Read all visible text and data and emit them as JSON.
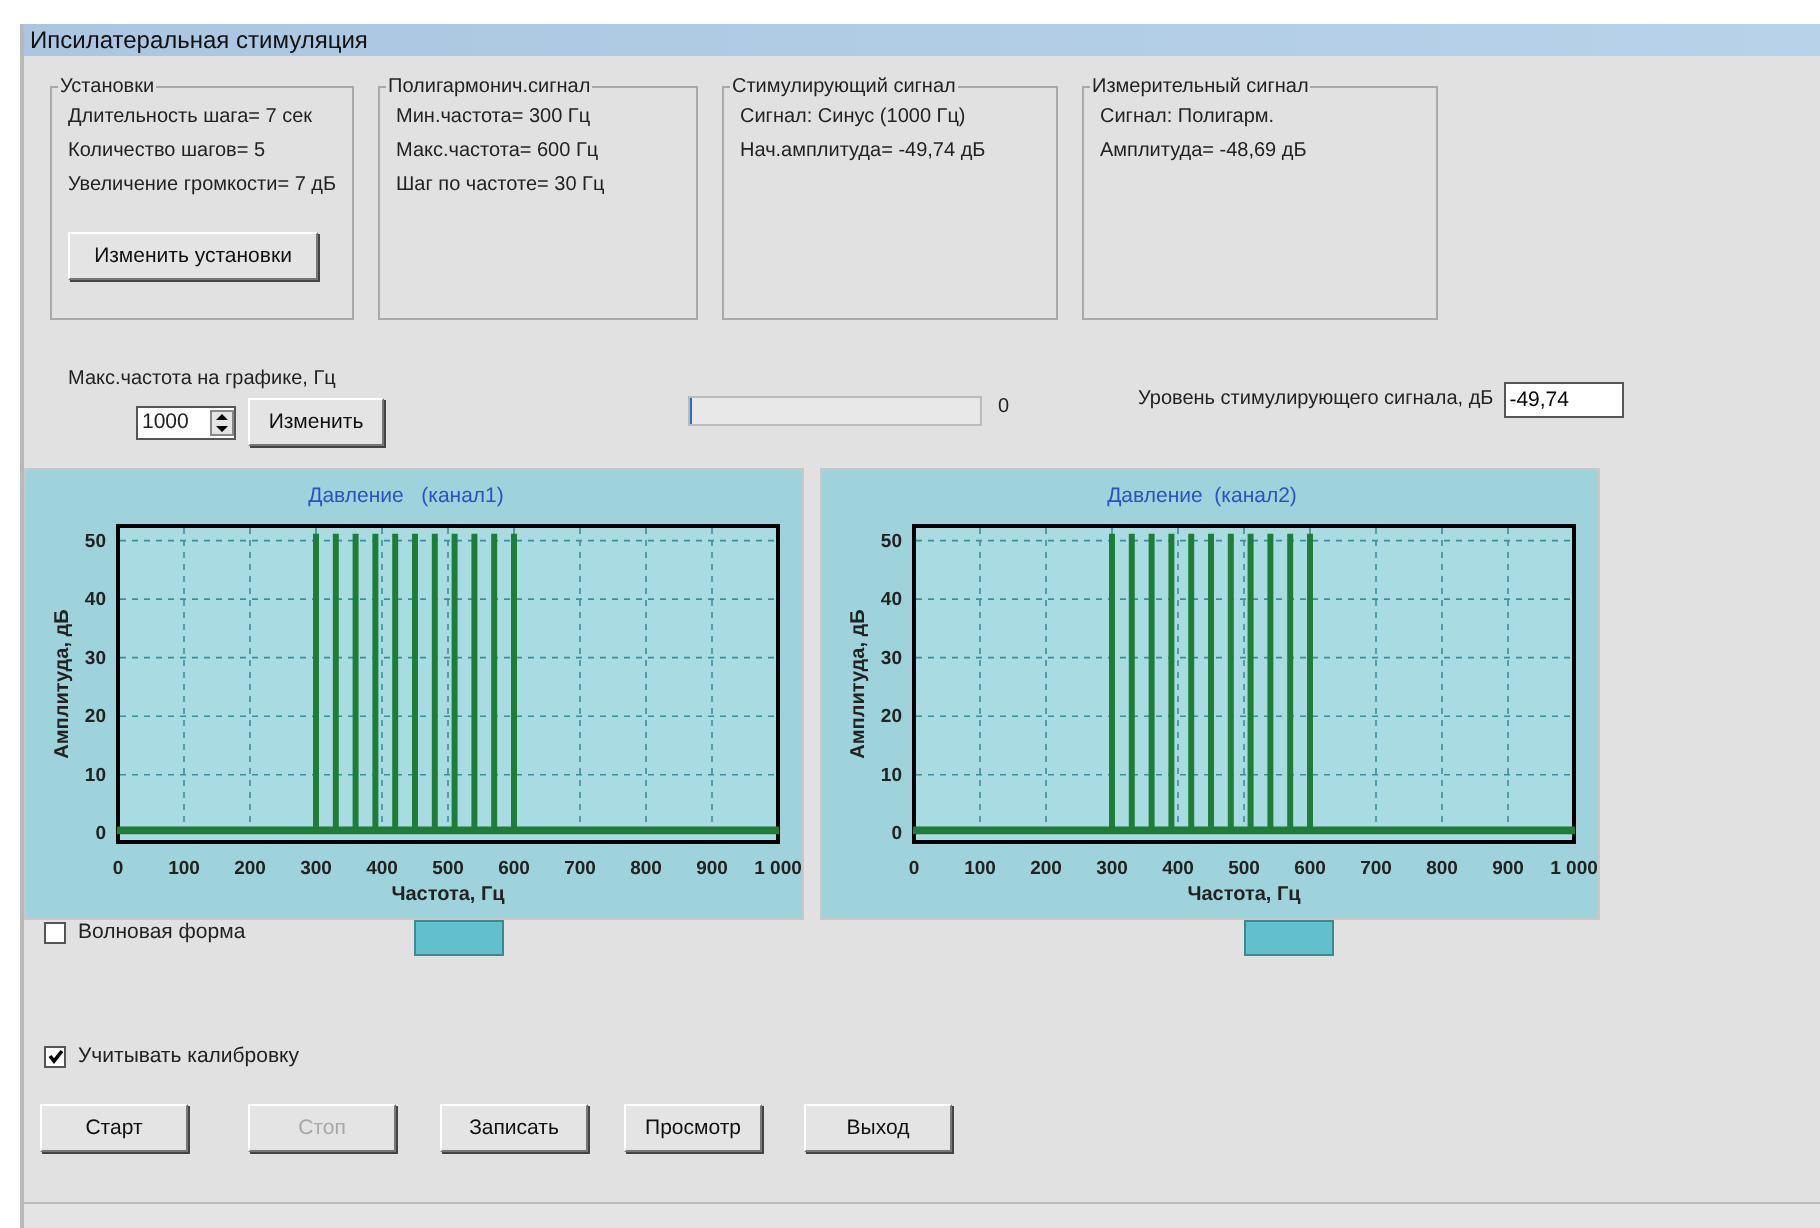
{
  "window": {
    "title": "Ипсилатеральная стимуляция"
  },
  "groups": [
    {
      "title": "Установки",
      "lines": [
        "Длительность шага= 7 сек",
        "Количество шагов= 5",
        "Увеличение громкости= 7 дБ"
      ],
      "button": "Изменить установки"
    },
    {
      "title": "Полигармонич.сигнал",
      "lines": [
        "Мин.частота= 300 Гц",
        "Макс.частота= 600 Гц",
        "Шаг по частоте= 30 Гц"
      ]
    },
    {
      "title": "Стимулирующий сигнал",
      "lines": [
        "Сигнал: Синус (1000 Гц)",
        "Нач.амплитуда= -49,74 дБ"
      ]
    },
    {
      "title": "Измерительный сигнал",
      "lines": [
        "Сигнал: Полигарм.",
        "Амплитуда= -48,69 дБ"
      ]
    }
  ],
  "max_freq": {
    "label": "Макс.частота на графике, Гц",
    "value": "1000",
    "button": "Изменить"
  },
  "progress": {
    "level": 0.01,
    "reading": "0"
  },
  "stim_level": {
    "label": "Уровень стимулирующего сигнала, дБ",
    "value": "-49,74"
  },
  "charts": [
    {
      "chart_data": {
        "type": "area",
        "title": "Давление   (канал1)",
        "xlabel": "Частота, Гц",
        "ylabel": "Амплитуда, дБ",
        "x": [
          0,
          297,
          297,
          303,
          303,
          327,
          327,
          333,
          333,
          357,
          357,
          363,
          363,
          387,
          387,
          393,
          393,
          417,
          417,
          423,
          423,
          447,
          447,
          453,
          453,
          477,
          477,
          483,
          483,
          507,
          507,
          513,
          513,
          537,
          537,
          543,
          543,
          567,
          567,
          573,
          573,
          597,
          597,
          603,
          603,
          1000
        ],
        "series": [
          {
            "color": "#1e7d36",
            "values": [
              1,
              1,
              51,
              51,
              1,
              1,
              51,
              51,
              1,
              1,
              51,
              51,
              1,
              1,
              51,
              51,
              1,
              1,
              51,
              51,
              1,
              1,
              51,
              51,
              1,
              1,
              51,
              51,
              1,
              1,
              51,
              51,
              1,
              1,
              51,
              51,
              1,
              1,
              51,
              51,
              1,
              1,
              51,
              51,
              1,
              1
            ]
          }
        ],
        "grid": true,
        "xlim": [
          0,
          1000
        ],
        "ylim": [
          -1.5,
          52.5
        ],
        "xticks": [
          0,
          100,
          200,
          300,
          400,
          500,
          600,
          700,
          800,
          900,
          {
            "value": 1000,
            "label": "1 000"
          }
        ],
        "yticks": [
          0,
          10,
          20,
          30,
          40,
          50
        ]
      }
    },
    {
      "chart_data": {
        "type": "area",
        "title": "Давление  (канал2)",
        "xlabel": "Частота, Гц",
        "ylabel": "Амплитуда, дБ",
        "x": [
          0,
          297,
          297,
          303,
          303,
          327,
          327,
          333,
          333,
          357,
          357,
          363,
          363,
          387,
          387,
          393,
          393,
          417,
          417,
          423,
          423,
          447,
          447,
          453,
          453,
          477,
          477,
          483,
          483,
          507,
          507,
          513,
          513,
          537,
          537,
          543,
          543,
          567,
          567,
          573,
          573,
          597,
          597,
          603,
          603,
          1000
        ],
        "series": [
          {
            "color": "#1e7d36",
            "values": [
              1,
              1,
              51,
              51,
              1,
              1,
              51,
              51,
              1,
              1,
              51,
              51,
              1,
              1,
              51,
              51,
              1,
              1,
              51,
              51,
              1,
              1,
              51,
              51,
              1,
              1,
              51,
              51,
              1,
              1,
              51,
              51,
              1,
              1,
              51,
              51,
              1,
              1,
              51,
              51,
              1,
              1,
              51,
              51,
              1,
              1
            ]
          }
        ],
        "grid": true,
        "xlim": [
          0,
          1000
        ],
        "ylim": [
          -1.5,
          52.5
        ],
        "xticks": [
          0,
          100,
          200,
          300,
          400,
          500,
          600,
          700,
          800,
          900,
          {
            "value": 1000,
            "label": "1 000"
          }
        ],
        "yticks": [
          0,
          10,
          20,
          30,
          40,
          50
        ]
      }
    }
  ],
  "waveform": {
    "label": "Волновая форма",
    "checked": false
  },
  "calibration": {
    "label": "Учитывать калибровку",
    "checked": true
  },
  "buttons": [
    {
      "label": "Старт",
      "disabled": false
    },
    {
      "label": "Стоп",
      "disabled": true
    },
    {
      "label": "Записать",
      "disabled": false
    },
    {
      "label": "Просмотр",
      "disabled": false
    },
    {
      "label": "Выход",
      "disabled": false
    }
  ]
}
